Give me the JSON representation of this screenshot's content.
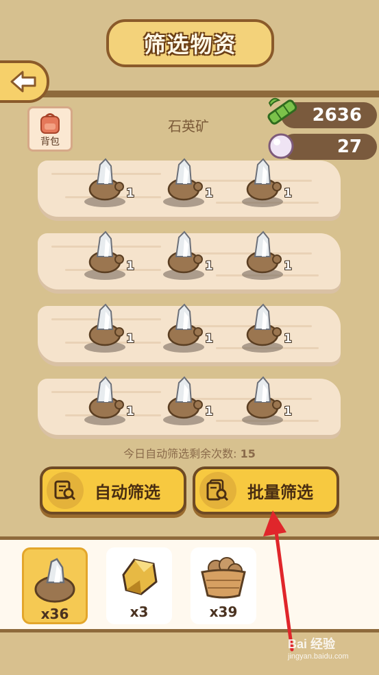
{
  "header": {
    "title": "筛选物资"
  },
  "bag": {
    "label": "背包"
  },
  "ore": {
    "name": "石英矿"
  },
  "currency": {
    "bamboo": "2636",
    "pearls": "27"
  },
  "grid": {
    "item_icon": "quartz-ore-icon",
    "rows": [
      [
        "1",
        "1",
        "1"
      ],
      [
        "1",
        "1",
        "1"
      ],
      [
        "1",
        "1",
        "1"
      ],
      [
        "1",
        "1",
        "1"
      ]
    ]
  },
  "remaining": {
    "label": "今日自动筛选剩余次数:",
    "count": "15"
  },
  "buttons": {
    "auto": "自动筛选",
    "batch": "批量筛选"
  },
  "inventory": [
    {
      "icon": "quartz-ore-icon",
      "count": "x36",
      "selected": true
    },
    {
      "icon": "gold-ore-icon",
      "count": "x3",
      "selected": false
    },
    {
      "icon": "potato-basket-icon",
      "count": "x39",
      "selected": false
    }
  ],
  "watermark": {
    "main": "Bai 经验",
    "sub": "jingyan.baidu.com"
  },
  "colors": {
    "accent": "#f7c940",
    "border": "#6e4a24",
    "arrow": "#e0262b"
  }
}
